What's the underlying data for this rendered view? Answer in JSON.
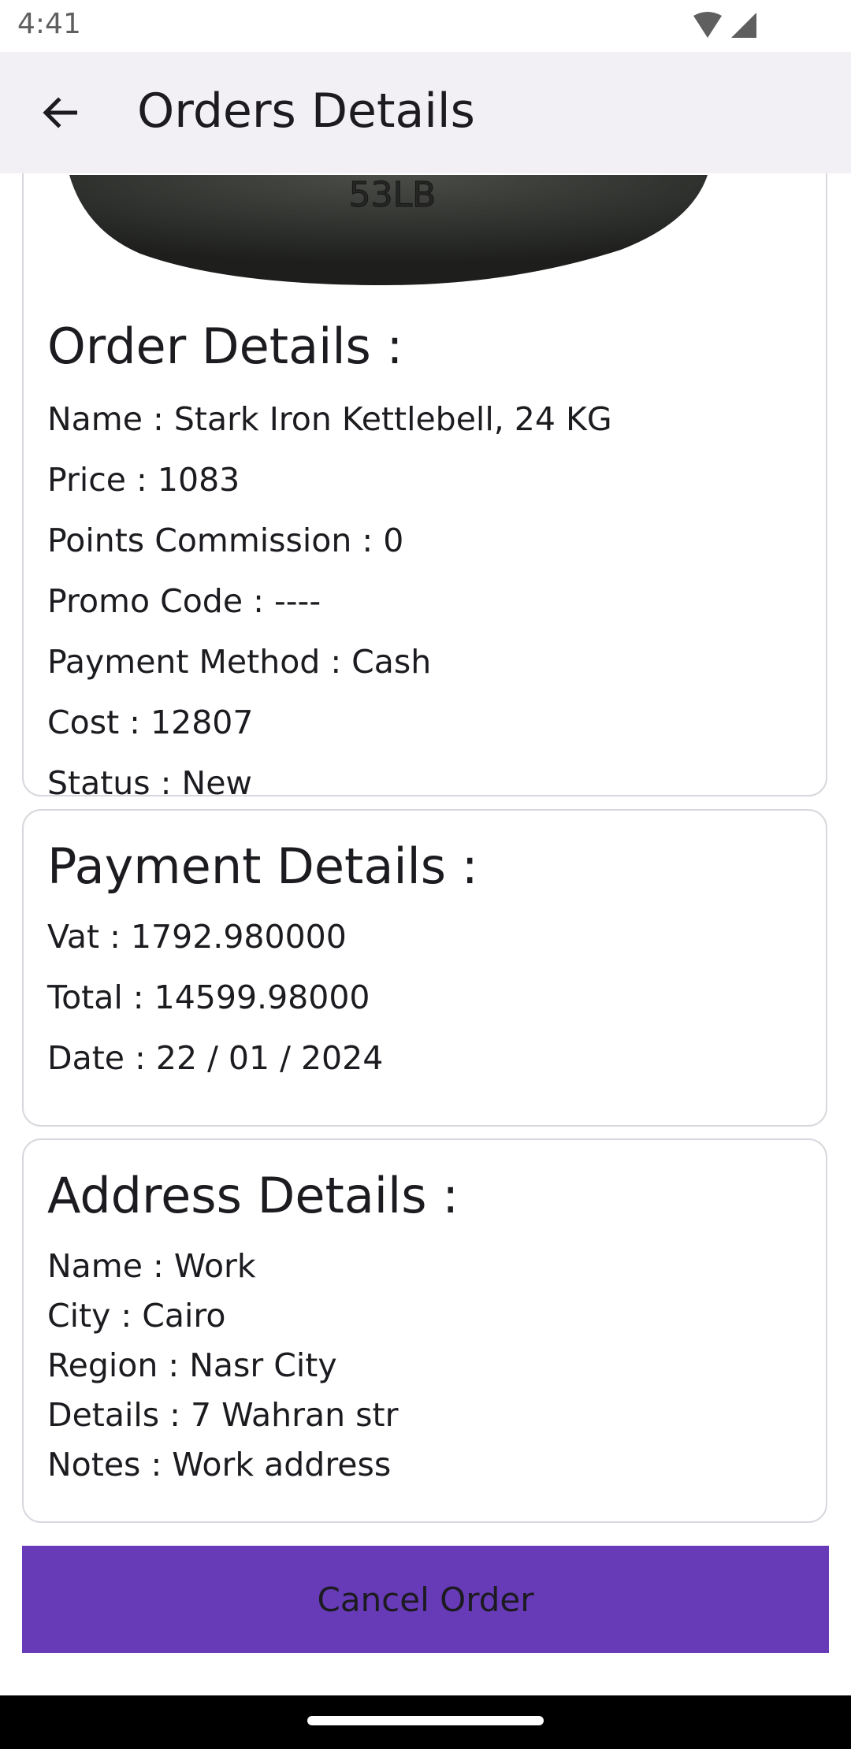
{
  "status_bar": {
    "time": "4:41",
    "icons": [
      "wifi-icon",
      "signal-icon"
    ]
  },
  "app_bar": {
    "title": "Orders Details",
    "back_icon": "arrow-left-icon"
  },
  "product_image": {
    "imprint": "53LB"
  },
  "order_details": {
    "title": "Order Details :",
    "lines": [
      "Name : Stark Iron Kettlebell, 24 KG",
      "Price : 1083",
      "Points Commission : 0",
      "Promo Code : ----",
      "Payment Method : Cash",
      "Cost : 12807",
      "Status : New"
    ]
  },
  "payment_details": {
    "title": "Payment Details :",
    "lines": [
      "Vat : 1792.980000",
      "Total : 14599.98000",
      "Date : 22 / 01 / 2024"
    ]
  },
  "address_details": {
    "title": "Address Details :",
    "lines": [
      "Name : Work",
      "City : Cairo",
      "Region : Nasr City",
      "Details : 7 Wahran str",
      "Notes : Work address"
    ]
  },
  "cancel_button": {
    "label": "Cancel Order"
  },
  "colors": {
    "accent": "#673ab7",
    "app_bar_bg": "#f2eff5",
    "card_border": "#d9d7dd"
  }
}
